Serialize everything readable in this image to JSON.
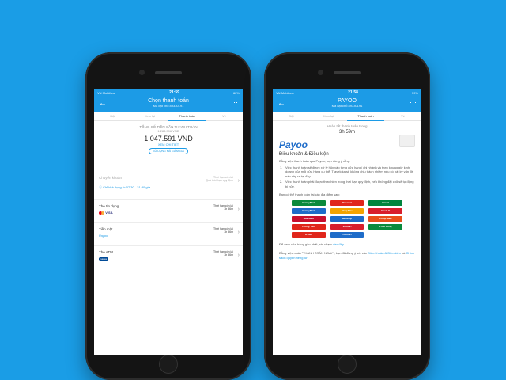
{
  "left": {
    "status": {
      "carrier": "VN Mobifone",
      "time": "21:59",
      "battery": "62%"
    },
    "nav": {
      "title": "Chọn thanh toán",
      "subtitle": "Mã đặt chỗ 89330191"
    },
    "tabs": [
      "Đặt",
      "Xem lại",
      "Thanh toán",
      "Vé"
    ],
    "active_tab": 2,
    "total": {
      "label": "TỔNG SỐ TIỀN CẦN THANH TOÁN",
      "old": "1.283.996 VND",
      "amount": "1.047.591 VND",
      "detail_link": "XEM CHI TIẾT",
      "coupon_button": "SỬ DỤNG MÃ GIẢM GIÁ"
    },
    "transfer": {
      "label": "Chuyển khoản",
      "limit_title": "Thời hạn còn lại",
      "limit_value": "Quá thời hạn quy định"
    },
    "info_note": "Chỉ khả dụng từ 07:30 - 21:30 giờ",
    "methods": [
      {
        "label": "Thẻ tín dụng",
        "brand": "VISA",
        "limit_title": "Thời hạn còn lại",
        "limit_value": "3h 56m"
      },
      {
        "label": "Tiền mặt",
        "brand": "Payoo",
        "limit_title": "Thời hạn còn lại",
        "limit_value": "3h 56m"
      },
      {
        "label": "Thẻ ATM",
        "brand": "napas",
        "limit_title": "Thời hạn còn lại",
        "limit_value": "3h 56m"
      }
    ]
  },
  "right": {
    "status": {
      "carrier": "VN Mobifone",
      "time": "21:58",
      "battery": "39%"
    },
    "nav": {
      "title": "PAYOO",
      "subtitle": "Mã đặt chỗ 89330191"
    },
    "tabs": [
      "Đặt",
      "Xem lại",
      "Thanh toán",
      "Vé"
    ],
    "active_tab": 2,
    "countdown": {
      "label": "Hoàn tất thanh toán trong",
      "value": "3h 59m"
    },
    "logo": "Payoo",
    "terms_title": "Điều khoản & Điều kiện",
    "intro": "Bằng việc thanh toán qua Payoo, bạn đồng ý rằng:",
    "items": [
      "Việc thanh toán sẽ được xử lý hủy vào từng cửa hàng/ chi nhánh và theo khung giờ kinh doanh của mỗi cửa hàng cụ thể. Traveloka sẽ không chịu trách nhiệm nếu có bất kỳ vấn đề nào xảy ra tại đây.",
      "Việc thanh toán phải được thực hiện trong thời hạn quy định, nếu không đặt chỗ sẽ tự động bị hủy."
    ],
    "stores_intro": "Bạn có thể thanh toán tại các địa điểm sau:",
    "stores": [
      {
        "name": "FamilyMart",
        "color": "#0a8a3c"
      },
      {
        "name": "B's mart",
        "color": "#e0261b"
      },
      {
        "name": "Bmart",
        "color": "#00853e"
      },
      {
        "name": "FamilyMart",
        "color": "#1e6cc9"
      },
      {
        "name": "Shop&Go",
        "color": "#f5a400"
      },
      {
        "name": "Circle K",
        "color": "#d81e2c"
      },
      {
        "name": "Guardian",
        "color": "#c8102e"
      },
      {
        "name": "Ministop",
        "color": "#1e6cc9"
      },
      {
        "name": "Co.op Mart",
        "color": "#e94e1b"
      },
      {
        "name": "Phong Tien",
        "color": "#e0261b"
      },
      {
        "name": "Vinmart",
        "color": "#d81e2c"
      },
      {
        "name": "Phúc Long",
        "color": "#0a8a3c"
      },
      {
        "name": "HTMP",
        "color": "#e0261b"
      },
      {
        "name": "Citimart",
        "color": "#1e6cc9"
      },
      {
        "name": "",
        "color": "#ffffff"
      }
    ],
    "nearest_prefix": "Để xem cửa hàng gần nhất, xin chạm",
    "nearest_link": "vào đây",
    "footer_prefix": "Bằng việc nhấn \"THANH TOÁN NGAY\", bạn đã đồng ý với các",
    "footer_link1": "Điều khoản & Điều kiện",
    "footer_mid": "và",
    "footer_link2": "Chính sách quyền riêng tư"
  }
}
